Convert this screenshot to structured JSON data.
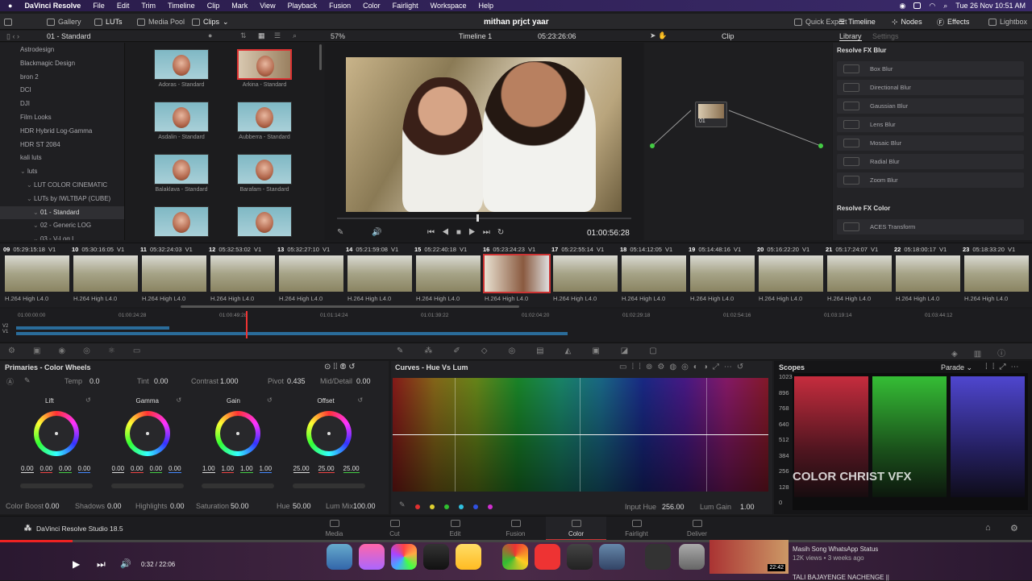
{
  "menubar": {
    "app": "DaVinci Resolve",
    "items": [
      "File",
      "Edit",
      "Trim",
      "Timeline",
      "Clip",
      "Mark",
      "View",
      "Playback",
      "Fusion",
      "Color",
      "Fairlight",
      "Workspace",
      "Help"
    ],
    "clock": "Tue 26 Nov  10:51 AM"
  },
  "toolbar": {
    "gallery": "Gallery",
    "luts": "LUTs",
    "media_pool": "Media Pool",
    "clips": "Clips",
    "project": "mithan prjct yaar",
    "quick_export": "Quick Export",
    "timeline": "Timeline",
    "nodes": "Nodes",
    "effects": "Effects",
    "lightbox": "Lightbox"
  },
  "header2": {
    "lut_folder": "01 - Standard",
    "zoom": "57%",
    "timeline_name": "Timeline 1",
    "timecode": "05:23:26:06",
    "clip": "Clip",
    "library_tab": "Library",
    "settings_tab": "Settings"
  },
  "lut_tree": [
    {
      "label": "Astrodesign",
      "sel": false,
      "ind": 0
    },
    {
      "label": "Blackmagic Design",
      "sel": false,
      "ind": 0
    },
    {
      "label": "bron 2",
      "sel": false,
      "ind": 0
    },
    {
      "label": "DCI",
      "sel": false,
      "ind": 0
    },
    {
      "label": "DJI",
      "sel": false,
      "ind": 0
    },
    {
      "label": "Film Looks",
      "sel": false,
      "ind": 0
    },
    {
      "label": "HDR Hybrid Log-Gamma",
      "sel": false,
      "ind": 0
    },
    {
      "label": "HDR ST 2084",
      "sel": false,
      "ind": 0
    },
    {
      "label": "kali luts",
      "sel": false,
      "ind": 0
    },
    {
      "label": "luts",
      "sel": false,
      "ind": -1
    },
    {
      "label": "LUT COLOR CINEMATIC",
      "sel": false,
      "ind": 1
    },
    {
      "label": "LUTs by IWLTBAP (CUBE)",
      "sel": false,
      "ind": 1
    },
    {
      "label": "01 - Standard",
      "sel": true,
      "ind": 2
    },
    {
      "label": "02 - Generic LOG",
      "sel": false,
      "ind": 2
    },
    {
      "label": "03 - V-Log L",
      "sel": false,
      "ind": 2
    }
  ],
  "lut_thumbs": [
    "Adoras - Standard",
    "Arkina - Standard",
    "Asdalin - Standard",
    "Aubberra - Standard",
    "Balaklava - Standard",
    "Barafam - Standard",
    "",
    ""
  ],
  "viewer": {
    "timecode": "01:00:56:28"
  },
  "node": {
    "label": "01"
  },
  "library": {
    "blur_title": "Resolve FX Blur",
    "blur_items": [
      "Box Blur",
      "Directional Blur",
      "Gaussian Blur",
      "Lens Blur",
      "Mosaic Blur",
      "Radial Blur",
      "Zoom Blur"
    ],
    "color_title": "Resolve FX Color",
    "color_items": [
      "ACES Transform"
    ]
  },
  "clips": [
    {
      "n": "09",
      "tc": "05:29:15:18",
      "t": "V1",
      "codec": "H.264 High L4.0"
    },
    {
      "n": "10",
      "tc": "05:30:16:05",
      "t": "V1",
      "codec": "H.264 High L4.0"
    },
    {
      "n": "11",
      "tc": "05:32:24:03",
      "t": "V1",
      "codec": "H.264 High L4.0"
    },
    {
      "n": "12",
      "tc": "05:32:53:02",
      "t": "V1",
      "codec": "H.264 High L4.0"
    },
    {
      "n": "13",
      "tc": "05:32:27:10",
      "t": "V1",
      "codec": "H.264 High L4.0"
    },
    {
      "n": "14",
      "tc": "05:21:59:08",
      "t": "V1",
      "codec": "H.264 High L4.0"
    },
    {
      "n": "15",
      "tc": "05:22:40:18",
      "t": "V1",
      "codec": "H.264 High L4.0"
    },
    {
      "n": "16",
      "tc": "05:23:24:23",
      "t": "V1",
      "codec": "H.264 High L4.0"
    },
    {
      "n": "17",
      "tc": "05:22:55:14",
      "t": "V1",
      "codec": "H.264 High L4.0"
    },
    {
      "n": "18",
      "tc": "05:14:12:05",
      "t": "V1",
      "codec": "H.264 High L4.0"
    },
    {
      "n": "19",
      "tc": "05:14:48:16",
      "t": "V1",
      "codec": "H.264 High L4.0"
    },
    {
      "n": "20",
      "tc": "05:16:22:20",
      "t": "V1",
      "codec": "H.264 High L4.0"
    },
    {
      "n": "21",
      "tc": "05:17:24:07",
      "t": "V1",
      "codec": "H.264 High L4.0"
    },
    {
      "n": "22",
      "tc": "05:18:00:17",
      "t": "V1",
      "codec": "H.264 High L4.0"
    },
    {
      "n": "23",
      "tc": "05:18:33:20",
      "t": "V1",
      "codec": "H.264 High L4.0"
    }
  ],
  "timeline": {
    "ticks": [
      "01:00:00:00",
      "01:00:24:28",
      "01:00:49:28",
      "01:01:14:24",
      "01:01:39:22",
      "01:02:04:20",
      "01:02:29:18",
      "01:02:54:16",
      "01:03:19:14",
      "01:03:44:12"
    ],
    "tracks": [
      "V2",
      "V1"
    ]
  },
  "primaries": {
    "title": "Primaries - Color Wheels",
    "temp_label": "Temp",
    "temp": "0.0",
    "tint_label": "Tint",
    "tint": "0.00",
    "contrast_label": "Contrast",
    "contrast": "1.000",
    "pivot_label": "Pivot",
    "pivot": "0.435",
    "middetail_label": "Mid/Detail",
    "middetail": "0.00",
    "wheels": [
      {
        "name": "Lift",
        "vals": [
          "0.00",
          "0.00",
          "0.00",
          "0.00"
        ]
      },
      {
        "name": "Gamma",
        "vals": [
          "0.00",
          "0.00",
          "0.00",
          "0.00"
        ]
      },
      {
        "name": "Gain",
        "vals": [
          "1.00",
          "1.00",
          "1.00",
          "1.00"
        ]
      },
      {
        "name": "Offset",
        "vals": [
          "25.00",
          "25.00",
          "25.00"
        ]
      }
    ],
    "colorboost_label": "Color Boost",
    "colorboost": "0.00",
    "shadows_label": "Shadows",
    "shadows": "0.00",
    "highlights_label": "Highlights",
    "highlights": "0.00",
    "saturation_label": "Saturation",
    "saturation": "50.00",
    "hue_label": "Hue",
    "hue": "50.00",
    "lummix_label": "Lum Mix",
    "lummix": "100.00"
  },
  "curves": {
    "title": "Curves - Hue Vs Lum",
    "inputhue_label": "Input Hue",
    "inputhue": "256.00",
    "lumgain_label": "Lum Gain",
    "lumgain": "1.00",
    "dot_colors": [
      "#e03030",
      "#e0d030",
      "#30c030",
      "#30c0e0",
      "#3050e0",
      "#d030d0"
    ]
  },
  "scopes": {
    "title": "Scopes",
    "mode": "Parade",
    "scale": [
      "1023",
      "896",
      "768",
      "640",
      "512",
      "384",
      "256",
      "128",
      "0"
    ],
    "watermark": "COLOR CHRIST VFX"
  },
  "pages": {
    "brand": "DaVinci Resolve Studio 18.5",
    "items": [
      "Media",
      "Cut",
      "Edit",
      "Fusion",
      "Color",
      "Fairlight",
      "Deliver"
    ],
    "active": "Color"
  },
  "player": {
    "time": "0:32 / 22:06",
    "yt_title": "Masih Song WhatsApp Status",
    "yt_meta": "12K views  •  3 weeks ago",
    "yt_dur": "22:42",
    "yt_title2": "TALI BAJAYENGE NACHENGE ||"
  }
}
